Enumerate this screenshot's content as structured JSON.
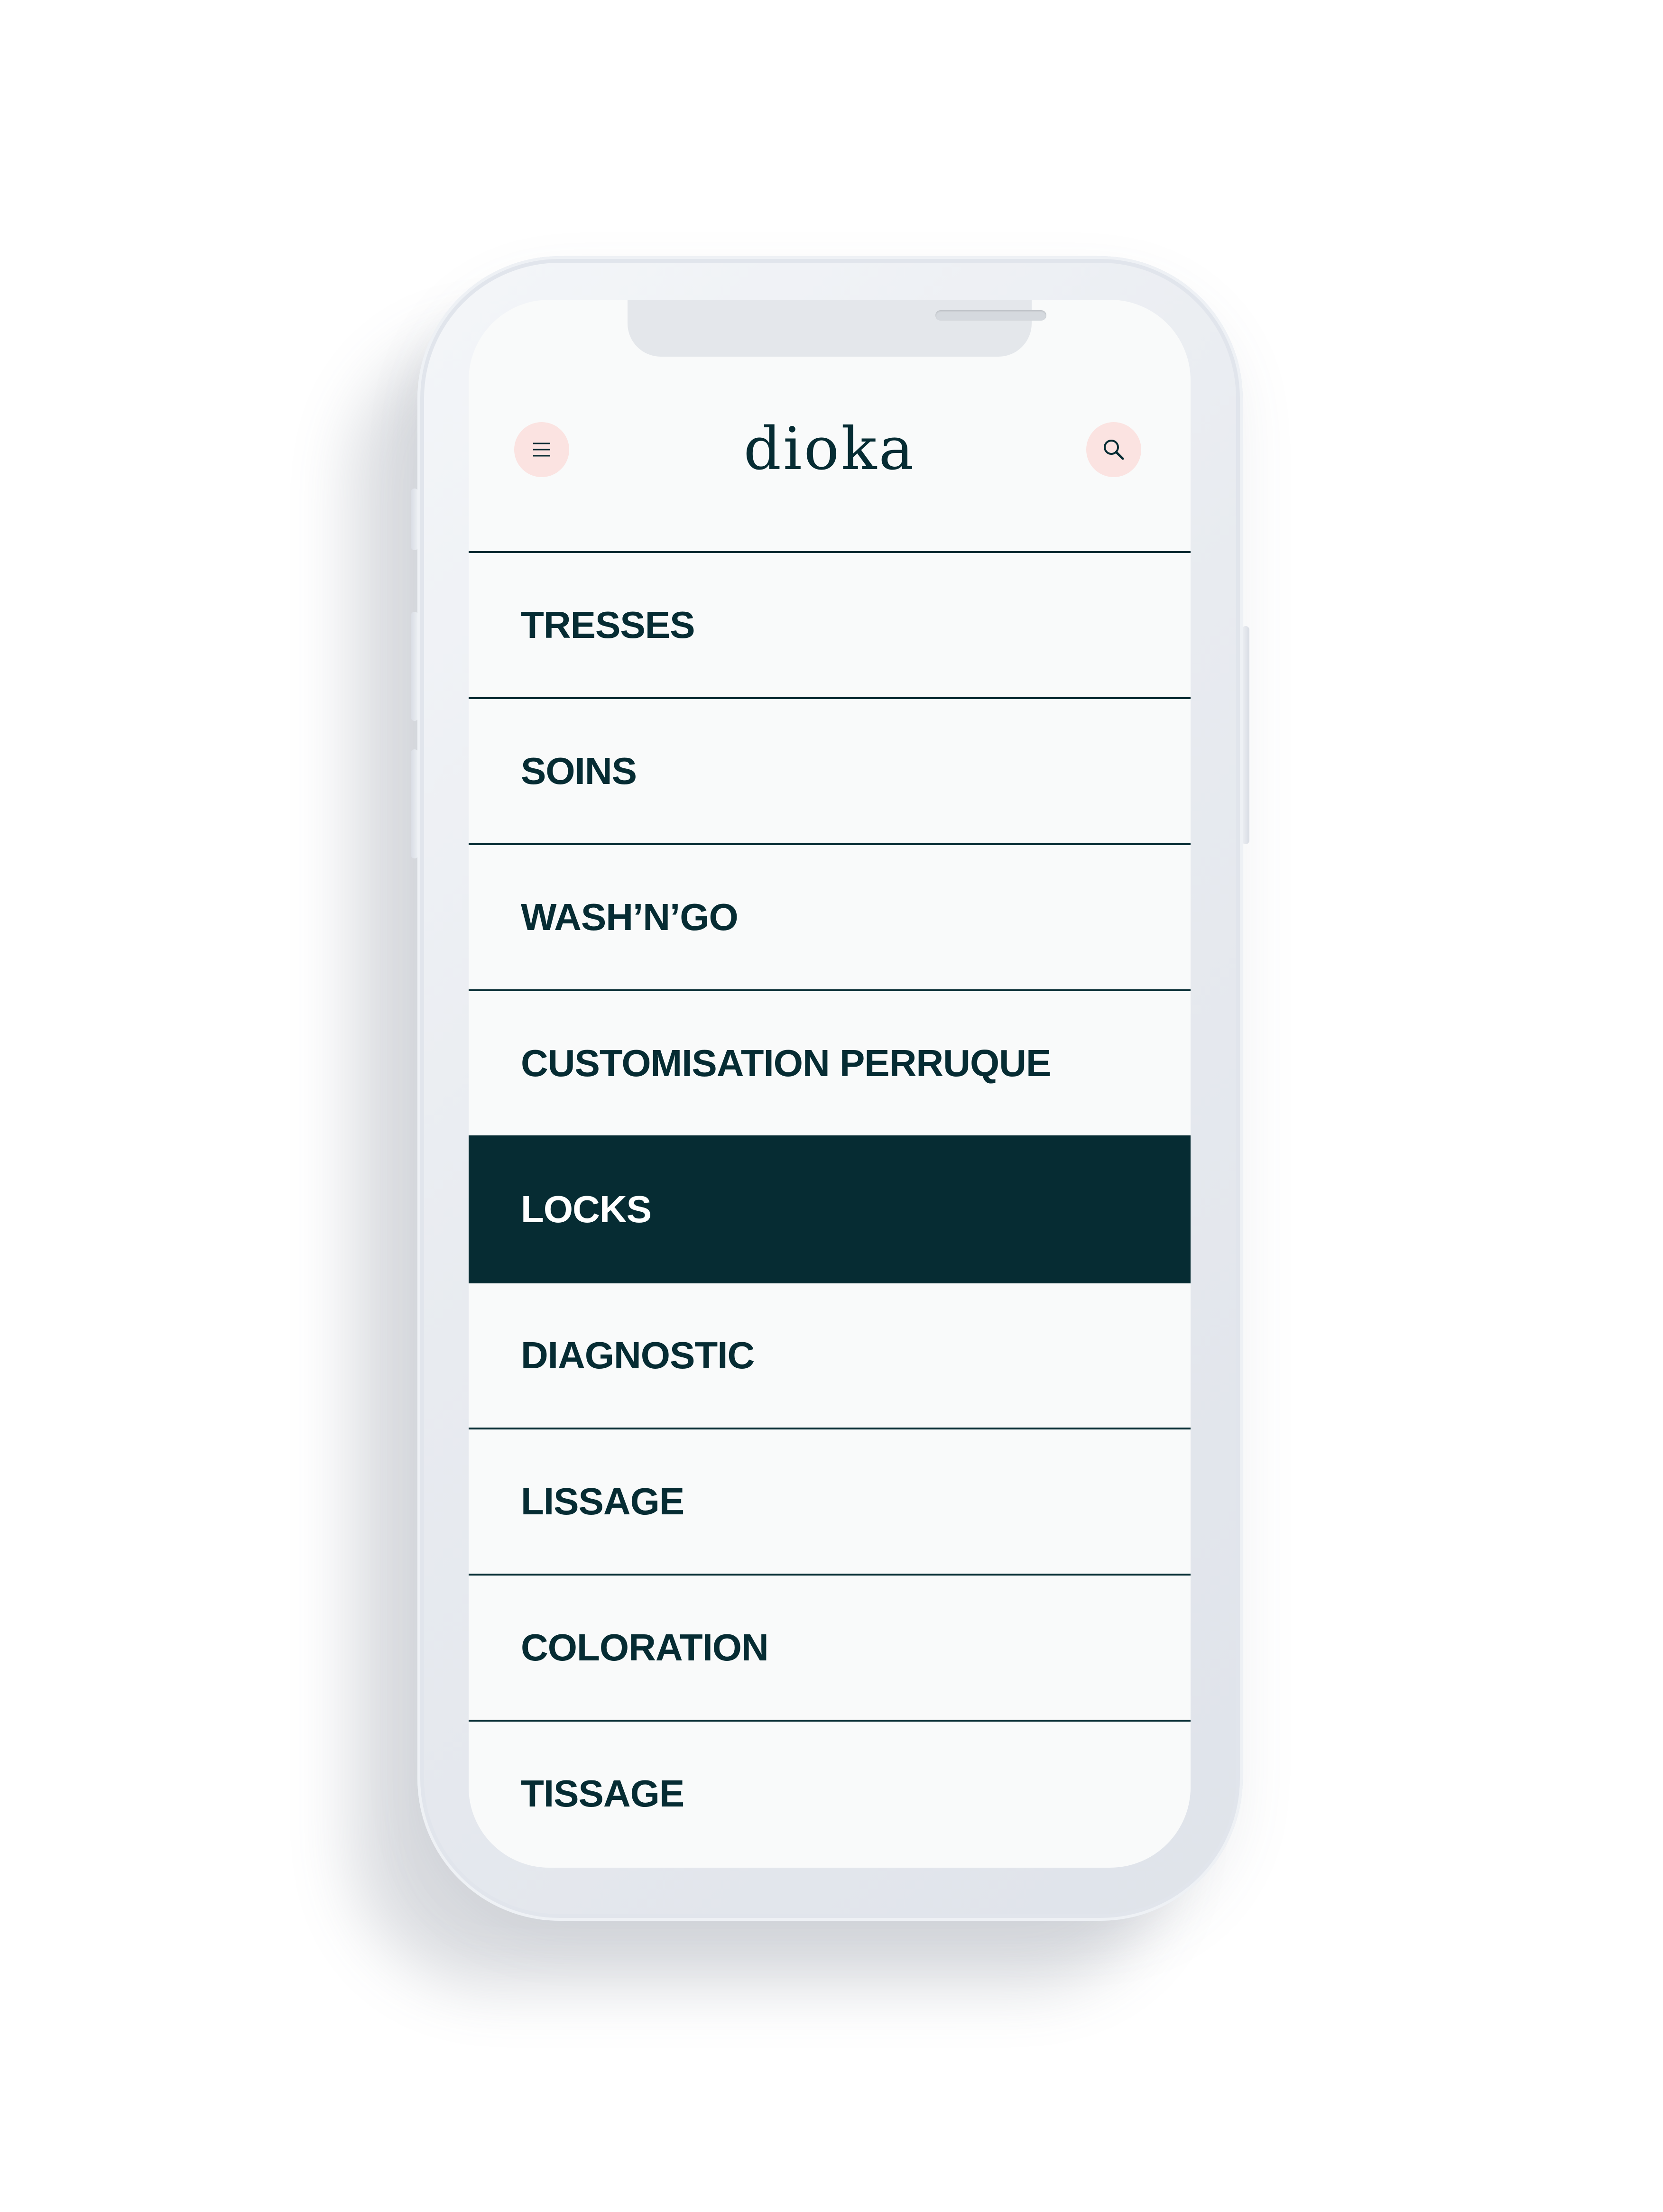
{
  "brand": {
    "logo_text": "dioka"
  },
  "header": {
    "menu_icon": "hamburger-icon",
    "search_icon": "search-icon"
  },
  "menu": {
    "active_index": 4,
    "items": [
      {
        "label": "TRESSES"
      },
      {
        "label": "SOINS"
      },
      {
        "label": "WASH’N’GO"
      },
      {
        "label": "CUSTOMISATION PERRUQUE"
      },
      {
        "label": "LOCKS"
      },
      {
        "label": "DIAGNOSTIC"
      },
      {
        "label": "LISSAGE"
      },
      {
        "label": "COLORATION"
      },
      {
        "label": "TISSAGE"
      }
    ]
  },
  "colors": {
    "primary": "#062c33",
    "accent_circle": "#fbe3e1",
    "screen_background": "#f9fafa",
    "active_text": "#ffffff"
  }
}
